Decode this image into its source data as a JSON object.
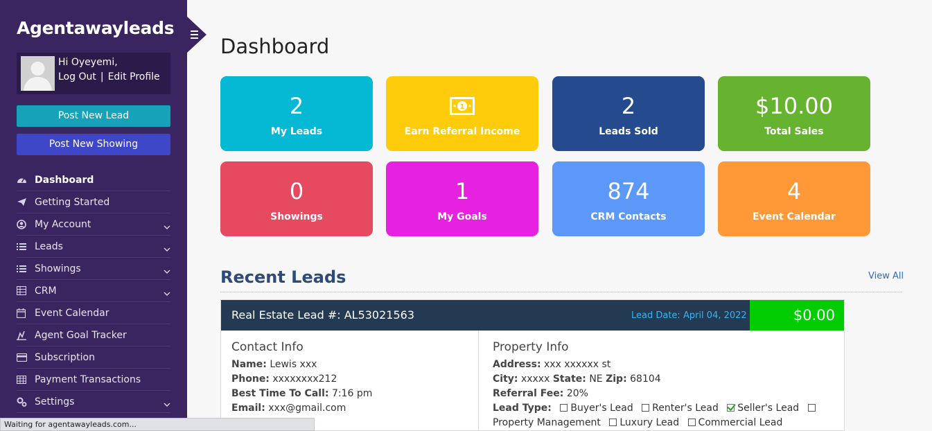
{
  "sidebar": {
    "brand": "Agentawayleads",
    "user": {
      "greeting": "Hi Oyeyemi,",
      "logout": "Log Out",
      "separator": "|",
      "edit_profile": "Edit Profile"
    },
    "buttons": {
      "post_lead": "Post New Lead",
      "post_showing": "Post New Showing"
    },
    "nav": [
      {
        "label": "Dashboard",
        "icon": "dashboard-icon",
        "active": true
      },
      {
        "label": "Getting Started",
        "icon": "paper-plane-icon"
      },
      {
        "label": "My Account",
        "icon": "user-circle-icon",
        "expandable": true
      },
      {
        "label": "Leads",
        "icon": "list-icon",
        "expandable": true
      },
      {
        "label": "Showings",
        "icon": "list-icon",
        "expandable": true
      },
      {
        "label": "CRM",
        "icon": "grid-icon",
        "expandable": true
      },
      {
        "label": "Event Calendar",
        "icon": "calendar-icon"
      },
      {
        "label": "Agent Goal Tracker",
        "icon": "goal-icon"
      },
      {
        "label": "Subscription",
        "icon": "credit-card-icon"
      },
      {
        "label": "Payment Transactions",
        "icon": "table-icon"
      },
      {
        "label": "Settings",
        "icon": "gears-icon",
        "expandable": true
      }
    ]
  },
  "main": {
    "title": "Dashboard",
    "tiles": [
      {
        "value": "2",
        "label": "My Leads",
        "color": "#05b8d3"
      },
      {
        "value": "",
        "label": "Earn Referral Income",
        "color": "#fecc0b",
        "icon": "money-bill-icon"
      },
      {
        "value": "2",
        "label": "Leads Sold",
        "color": "#254b8e"
      },
      {
        "value": "$10.00",
        "label": "Total Sales",
        "color": "#65b32e"
      },
      {
        "value": "0",
        "label": "Showings",
        "color": "#e54a61"
      },
      {
        "value": "1",
        "label": "My Goals",
        "color": "#e622e0"
      },
      {
        "value": "874",
        "label": "CRM Contacts",
        "color": "#5c98f8"
      },
      {
        "value": "4",
        "label": "Event Calendar",
        "color": "#ff9836"
      }
    ],
    "recent": {
      "title": "Recent Leads",
      "view_all": "View All",
      "lead": {
        "title": "Real Estate Lead #: AL53021563",
        "date": "Lead Date: April 04, 2022",
        "price": "$0.00",
        "contact": {
          "heading": "Contact Info",
          "name_label": "Name:",
          "name": "Lewis xxx",
          "phone_label": "Phone:",
          "phone": "xxxxxxxx212",
          "time_label": "Best Time To Call:",
          "time": "7:16 pm",
          "email_label": "Email:",
          "email": "xxx@gmail.com"
        },
        "property": {
          "heading": "Property Info",
          "address_label": "Address:",
          "address": "xxx xxxxxx st",
          "city_label": "City:",
          "city": "xxxxx",
          "state_label": "State:",
          "state": "NE",
          "zip_label": "Zip:",
          "zip": "68104",
          "fee_label": "Referral Fee:",
          "fee": "20%",
          "type_label": "Lead Type:",
          "types": [
            {
              "label": "Buyer's Lead",
              "checked": false
            },
            {
              "label": "Renter's Lead",
              "checked": false
            },
            {
              "label": "Seller's Lead",
              "checked": true
            },
            {
              "label": "Property Management",
              "checked": false
            },
            {
              "label": "Luxury Lead",
              "checked": false
            },
            {
              "label": "Commercial Lead",
              "checked": false
            }
          ]
        }
      }
    }
  },
  "status_bar": "Waiting for agentawayleads.com..."
}
